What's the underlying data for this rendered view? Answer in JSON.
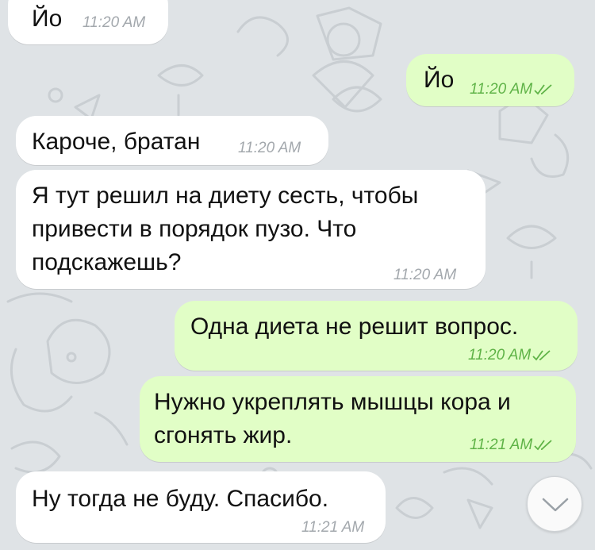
{
  "colors": {
    "background": "#dfe3e6",
    "incoming_bubble": "#ffffff",
    "outgoing_bubble": "#e1fec6",
    "incoming_time": "#a3a8ad",
    "outgoing_time": "#5fb347"
  },
  "messages": [
    {
      "id": "b1",
      "direction": "incoming",
      "text": "Йо",
      "time": "11:20 AM"
    },
    {
      "id": "b2",
      "direction": "outgoing",
      "text": "Йо",
      "time": "11:20 AM",
      "status_icon": "double-check-icon"
    },
    {
      "id": "b3",
      "direction": "incoming",
      "text": "Кароче, братан",
      "time": "11:20 AM"
    },
    {
      "id": "b4",
      "direction": "incoming",
      "text": "Я тут решил на диету сесть, чтобы\nпривести в порядок пузо. Что\nподскажешь?",
      "time": "11:20 AM"
    },
    {
      "id": "b5",
      "direction": "outgoing",
      "text": "Одна диета не решит вопрос.",
      "time": "11:20 AM",
      "status_icon": "double-check-icon"
    },
    {
      "id": "b6",
      "direction": "outgoing",
      "text": "Нужно укреплять мышцы кора и\nсгонять жир.",
      "time": "11:21 AM",
      "status_icon": "double-check-icon"
    },
    {
      "id": "b7",
      "direction": "incoming",
      "text": "Ну тогда не буду. Спасибо.",
      "time": "11:21 AM"
    }
  ],
  "scroll_down_icon": "chevron-down-icon"
}
